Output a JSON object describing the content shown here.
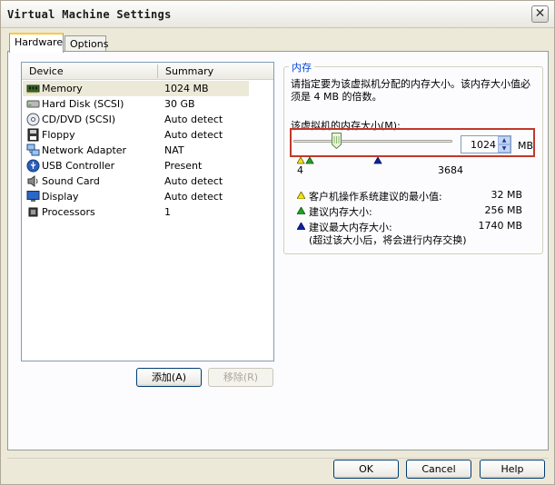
{
  "window": {
    "title": "Virtual Machine Settings"
  },
  "tabs": [
    {
      "label": "Hardware",
      "active": true
    },
    {
      "label": "Options",
      "active": false
    }
  ],
  "device_list": {
    "columns": [
      "Device",
      "Summary"
    ],
    "rows": [
      {
        "name": "Memory",
        "summary": "1024 MB",
        "icon": "memory-icon",
        "selected": true
      },
      {
        "name": "Hard Disk (SCSI)",
        "summary": "30 GB",
        "icon": "hard-disk-icon"
      },
      {
        "name": "CD/DVD (SCSI)",
        "summary": "Auto detect",
        "icon": "cd-dvd-icon"
      },
      {
        "name": "Floppy",
        "summary": "Auto detect",
        "icon": "floppy-icon"
      },
      {
        "name": "Network Adapter",
        "summary": "NAT",
        "icon": "network-adapter-icon"
      },
      {
        "name": "USB Controller",
        "summary": "Present",
        "icon": "usb-icon"
      },
      {
        "name": "Sound Card",
        "summary": "Auto detect",
        "icon": "speaker-icon"
      },
      {
        "name": "Display",
        "summary": "Auto detect",
        "icon": "display-icon"
      },
      {
        "name": "Processors",
        "summary": "1",
        "icon": "processor-icon"
      }
    ]
  },
  "list_buttons": {
    "add": "添加(A)",
    "remove": "移除(R)"
  },
  "memory": {
    "group_title": "内存",
    "description": "请指定要为该虚拟机分配的内存大小。该内存大小值必须是 4 MB 的倍数。",
    "field_label": "该虚拟机的内存大小(M):",
    "value": "1024",
    "unit": "MB",
    "slider_min_label": "4",
    "slider_max_label": "3684",
    "slider_fraction": 0.27,
    "legend": [
      {
        "text": "客户机操作系统建议的最小值:",
        "value": "32 MB",
        "color": "#f2e21b"
      },
      {
        "text": "建议内存大小:",
        "value": "256 MB",
        "color": "#1fa51f"
      },
      {
        "text": "建议最大内存大小:",
        "value": "1740 MB",
        "color": "#0a23a8"
      }
    ],
    "legend_note": "(超过该大小后，将会进行内存交换)"
  },
  "footer_buttons": {
    "ok": "OK",
    "cancel": "Cancel",
    "help": "Help"
  }
}
